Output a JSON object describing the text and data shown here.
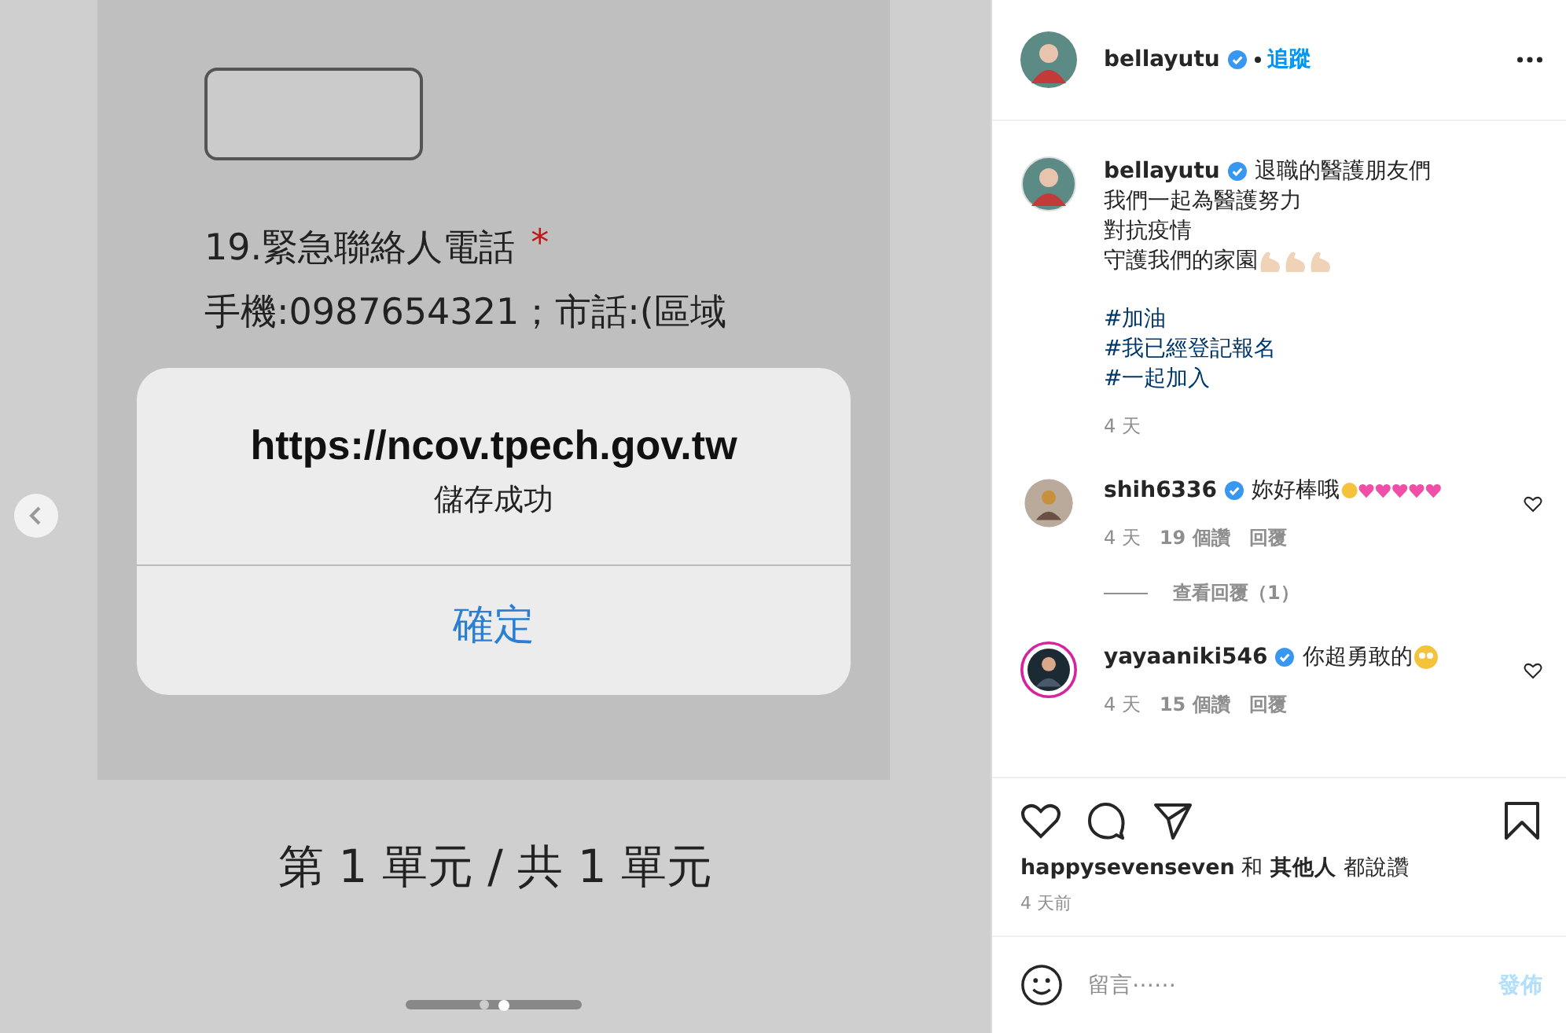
{
  "post_image": {
    "question_label": "19.緊急聯絡人電話",
    "required_mark": "*",
    "hint": "手機:0987654321；市話:(區域",
    "alert": {
      "title": "https://ncov.tpech.gov.tw",
      "message": "儲存成功",
      "button": "確定"
    },
    "page_indicator": "第 1 單元 / 共 1 單元"
  },
  "carousel": {
    "dots": [
      {
        "selected": false
      },
      {
        "selected": true
      }
    ]
  },
  "header": {
    "username": "bellayutu",
    "verified": true,
    "follow": "追蹤"
  },
  "caption": {
    "username": "bellayutu",
    "verified": true,
    "lines": [
      "退職的醫護朋友們",
      "我們一起為醫護努力",
      "對抗疫情",
      "守護我們的家園"
    ],
    "hashtags": [
      "#加油",
      "#我已經登記報名",
      "#一起加入"
    ],
    "time": "4 天"
  },
  "comments": [
    {
      "username": "shih6336",
      "verified": true,
      "story_ring": false,
      "text": "妳好棒哦",
      "time": "4 天",
      "likes": "19 個讚",
      "reply": "回覆",
      "view_replies": "查看回覆（1）"
    },
    {
      "username": "yayaaniki546",
      "verified": true,
      "story_ring": true,
      "text": "你超勇敢的",
      "time": "4 天",
      "likes": "15 個讚",
      "reply": "回覆"
    }
  ],
  "likes": "**happysevenseven** 和 **其他人** 都說讚",
  "time": "4 天前",
  "comment_box": {
    "placeholder": "留言⋯⋯",
    "post_button": "發佈",
    "post_disabled": true
  }
}
